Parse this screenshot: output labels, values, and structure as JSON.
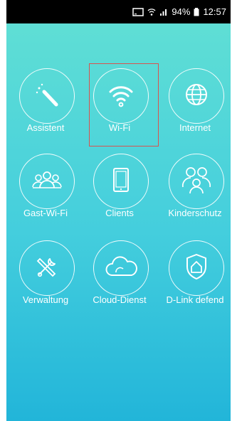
{
  "status_bar": {
    "battery_text": "94%",
    "time": "12:57",
    "icons": [
      "cast-icon",
      "wifi-status-icon",
      "signal-icon",
      "battery-icon"
    ]
  },
  "tiles": [
    {
      "label": "Assistent",
      "icon": "magic-wand-icon"
    },
    {
      "label": "Wi-Fi",
      "icon": "wifi-icon",
      "selected": true
    },
    {
      "label": "Internet",
      "icon": "globe-icon"
    },
    {
      "label": "Gast-Wi-Fi",
      "icon": "guest-users-icon"
    },
    {
      "label": "Clients",
      "icon": "tablet-icon"
    },
    {
      "label": "Kinderschutz",
      "icon": "family-icon"
    },
    {
      "label": "Verwaltung",
      "icon": "tools-icon"
    },
    {
      "label": "Cloud-Dienst",
      "icon": "cloud-icon"
    },
    {
      "label": "D-Link defend",
      "icon": "shield-house-icon"
    }
  ],
  "colors": {
    "background_top": "#62e0d4",
    "background_bottom": "#22b5d9",
    "selection_border": "#d9534f"
  }
}
